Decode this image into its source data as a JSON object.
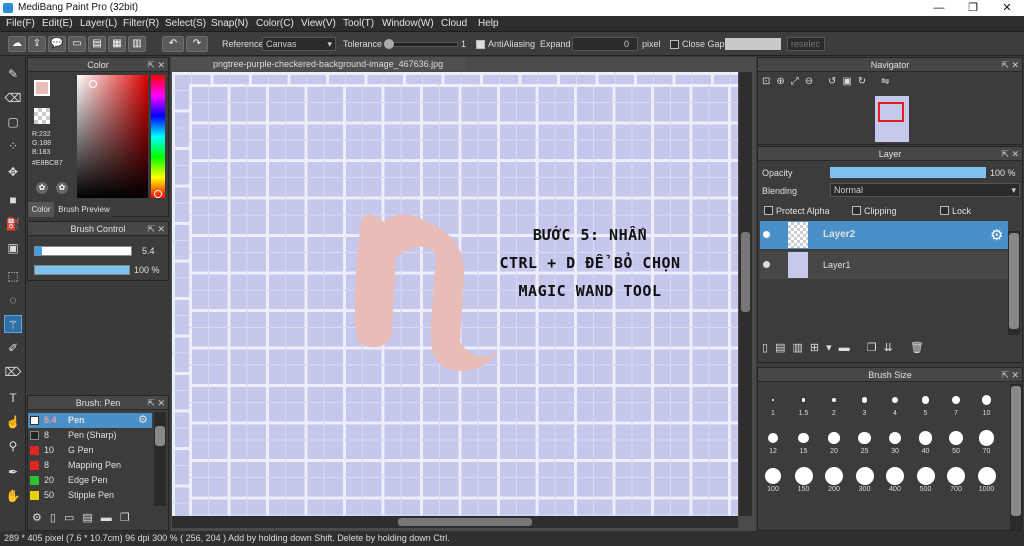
{
  "window": {
    "title": "MediBang Paint Pro (32bit)",
    "min": "—",
    "max": "❐",
    "close": "✕"
  },
  "menu": [
    "File(F)",
    "Edit(E)",
    "Layer(L)",
    "Filter(R)",
    "Select(S)",
    "Snap(N)",
    "Color(C)",
    "View(V)",
    "Tool(T)",
    "Window(W)",
    "Cloud",
    "Help"
  ],
  "toolbar": {
    "reference_label": "Reference",
    "reference_value": "Canvas",
    "tolerance_label": "Tolerance",
    "tolerance_value": "1",
    "antialiasing_label": "AntiAliasing",
    "expand_label": "Expand",
    "expand_value": "0",
    "expand_unit": "pixel",
    "close_gaps_label": "Close Gaps",
    "reselect_label": "reselec"
  },
  "color_panel": {
    "title": "Color",
    "r": "R:232",
    "g": "G:188",
    "b": "B:183",
    "hex": "#E8BCB7",
    "tab_color": "Color",
    "tab_brush_preview": "Brush Preview",
    "fg_color": "#E8BCB7"
  },
  "brush_control": {
    "title": "Brush Control",
    "size_value": "5.4",
    "opacity_value": "100 %",
    "opacity_fraction": 1.0
  },
  "brush_list": {
    "title": "Brush: Pen",
    "items": [
      {
        "size": "5.4",
        "name": "Pen",
        "color": "#ffffff"
      },
      {
        "size": "8",
        "name": "Pen (Sharp)",
        "color": "#222222"
      },
      {
        "size": "10",
        "name": "G Pen",
        "color": "#e02424"
      },
      {
        "size": "8",
        "name": "Mapping Pen",
        "color": "#e02424"
      },
      {
        "size": "20",
        "name": "Edge Pen",
        "color": "#2fbf2f"
      },
      {
        "size": "50",
        "name": "Stipple Pen",
        "color": "#e8d100"
      }
    ]
  },
  "document": {
    "tab_name": "pngtree-purple-checkered-background-image_467636.jpg"
  },
  "canvas_text": {
    "line1": "BƯỚC 5: NHẤN",
    "line2": "CTRL + D ĐỂ BỎ CHỌN",
    "line3": "MAGIC WAND TOOL",
    "glyph": "n"
  },
  "navigator": {
    "title": "Navigator"
  },
  "layer_panel": {
    "title": "Layer",
    "opacity_label": "Opacity",
    "opacity_value": "100 %",
    "opacity_fraction": 1.0,
    "blending_label": "Blending",
    "blending_value": "Normal",
    "protect_alpha": "Protect Alpha",
    "clipping": "Clipping",
    "lock": "Lock",
    "layers": [
      {
        "name": "Layer2",
        "selected": true
      },
      {
        "name": "Layer1",
        "selected": false
      }
    ]
  },
  "brush_size": {
    "title": "Brush Size",
    "sizes": [
      "1",
      "1.5",
      "2",
      "3",
      "4",
      "5",
      "7",
      "10",
      "12",
      "15",
      "20",
      "25",
      "30",
      "40",
      "50",
      "70",
      "100",
      "150",
      "200",
      "300",
      "400",
      "500",
      "700",
      "1000"
    ]
  },
  "status": {
    "text": "289 * 405 pixel  (7.6 * 10.7cm)  96 dpi  300 %  ( 256, 204 )  Add by holding down Shift. Delete by holding down Ctrl."
  }
}
